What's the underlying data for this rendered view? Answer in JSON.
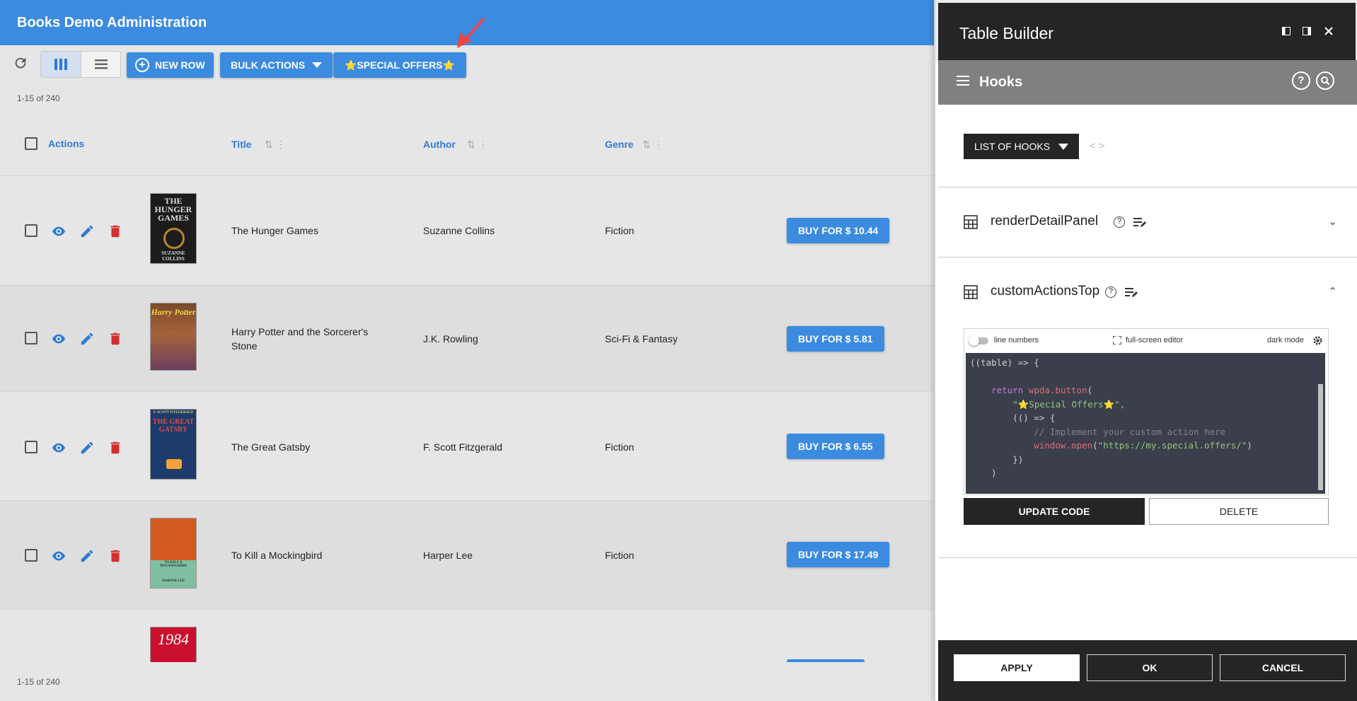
{
  "app": {
    "title": "Books Demo Administration"
  },
  "toolbar": {
    "new_row_label": "NEW ROW",
    "bulk_actions_label": "BULK ACTIONS",
    "special_offers_label": "⭐SPECIAL OFFERS⭐"
  },
  "pagination": {
    "top_count": "1-15 of 240",
    "bottom_count": "1-15 of 240"
  },
  "columns": {
    "actions": "Actions",
    "title": "Title",
    "author": "Author",
    "genre": "Genre"
  },
  "rows": [
    {
      "title": "The Hunger Games",
      "author": "Suzanne Collins",
      "genre": "Fiction",
      "buy": "BUY FOR $ 10.44",
      "cover_text": "THE HUNGER GAMES",
      "cover_author": "SUZANNE COLLINS"
    },
    {
      "title": "Harry Potter and the Sorcerer's Stone",
      "author": "J.K. Rowling",
      "genre": "Sci-Fi & Fantasy",
      "buy": "BUY FOR $ 5.81",
      "cover_text": "Harry Potter",
      "cover_author": ""
    },
    {
      "title": "The Great Gatsby",
      "author": "F. Scott Fitzgerald",
      "genre": "Fiction",
      "buy": "BUY FOR $ 6.55",
      "cover_text": "THE GREAT GATSBY",
      "cover_author": "F. SCOTT FITZGERALD"
    },
    {
      "title": "To Kill a Mockingbird",
      "author": "Harper Lee",
      "genre": "Fiction",
      "buy": "BUY FOR $ 17.49",
      "cover_text": "TO KILL A MOCKINGBIRD",
      "cover_author": "HARPER LEE"
    },
    {
      "title": "",
      "author": "",
      "genre": "",
      "buy": "",
      "cover_text": "1984",
      "cover_author": ""
    }
  ],
  "panel": {
    "title": "Table Builder",
    "section_title": "Hooks",
    "list_of_hooks_label": "LIST OF HOOKS",
    "hooks": [
      {
        "name": "renderDetailPanel",
        "expanded": false
      },
      {
        "name": "customActionsTop",
        "expanded": true
      }
    ],
    "editor": {
      "line_numbers_label": "line numbers",
      "fullscreen_label": "full-screen editor",
      "dark_mode_label": "dark mode",
      "code_lines": [
        "((table) => {",
        "",
        "    return wpda.button(",
        "        \"⭐Special Offers⭐\",",
        "        (() => {",
        "            // Implement your custom action here",
        "            window.open(\"https://my.special.offers/\")",
        "        })",
        "    )"
      ]
    },
    "update_code_label": "UPDATE CODE",
    "delete_label": "DELETE",
    "footer": {
      "apply_label": "APPLY",
      "ok_label": "OK",
      "cancel_label": "CANCEL"
    }
  },
  "colors": {
    "primary": "#3b8be0",
    "delete_icon": "#d32f2f",
    "panel_dark": "#252525",
    "panel_subheader": "#808080",
    "arrow": "#f04545"
  }
}
